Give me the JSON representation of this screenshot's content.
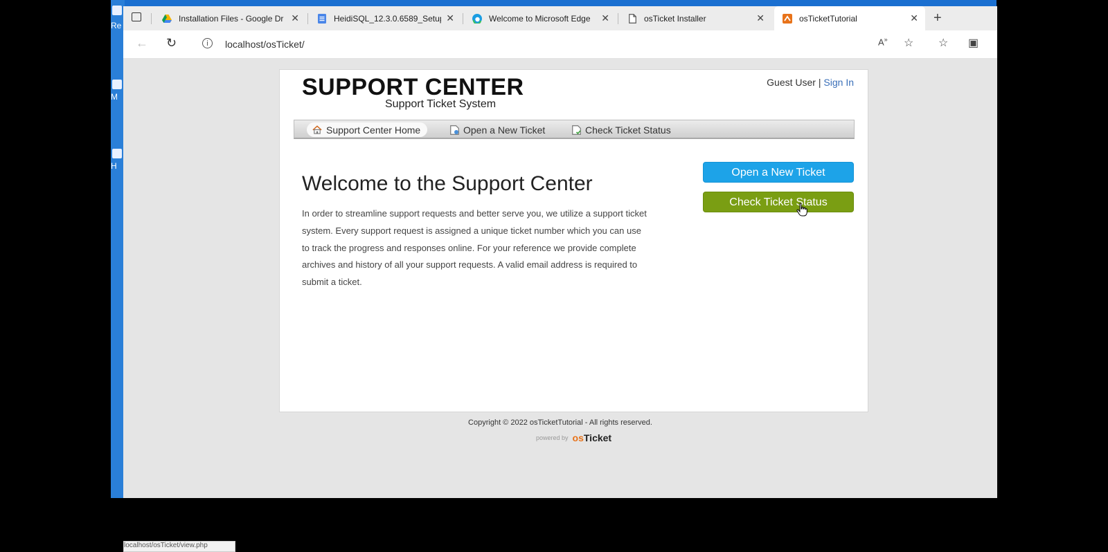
{
  "desktop": {
    "icon_labels": [
      "Re",
      "M",
      "H"
    ]
  },
  "tabs": [
    {
      "title": "Installation Files - Google Dr",
      "icon": "google-drive-icon"
    },
    {
      "title": "HeidiSQL_12.3.0.6589_Setup",
      "icon": "document-icon"
    },
    {
      "title": "Welcome to Microsoft Edge",
      "icon": "edge-icon"
    },
    {
      "title": "osTicket Installer",
      "icon": "page-icon"
    },
    {
      "title": "osTicketTutorial",
      "icon": "osticket-favicon"
    }
  ],
  "address": {
    "url": "localhost/osTicket/"
  },
  "header": {
    "logo_main": "SUPPORT CENTER",
    "logo_sub": "Support Ticket System",
    "guest": "Guest User",
    "separator": "|",
    "sign_in": "Sign In"
  },
  "nav": [
    {
      "label": "Support Center Home",
      "icon": "home-icon"
    },
    {
      "label": "Open a New Ticket",
      "icon": "new-ticket-icon"
    },
    {
      "label": "Check Ticket Status",
      "icon": "ticket-status-icon"
    }
  ],
  "main": {
    "welcome": "Welcome to the Support Center",
    "lines": [
      "In order to streamline support requests and better serve you, we utilize a support ticket",
      "system. Every support request is assigned a unique ticket number which you can use",
      "to track the progress and responses online. For your reference we provide complete",
      "archives and history of all your support requests. A valid email address is required to",
      "submit a ticket."
    ]
  },
  "sidebar": {
    "open_label": "Open a New Ticket",
    "check_label": "Check Ticket Status",
    "open_color": "#1da3e8",
    "check_color": "#7a9e13"
  },
  "footer": {
    "copyright": "Copyright © 2022 osTicketTutorial - All rights reserved.",
    "powered_by": "powered by",
    "brand_o": "os",
    "brand_rest": "Ticket"
  },
  "statusbar": {
    "text": "localhost/osTicket/view.php"
  }
}
